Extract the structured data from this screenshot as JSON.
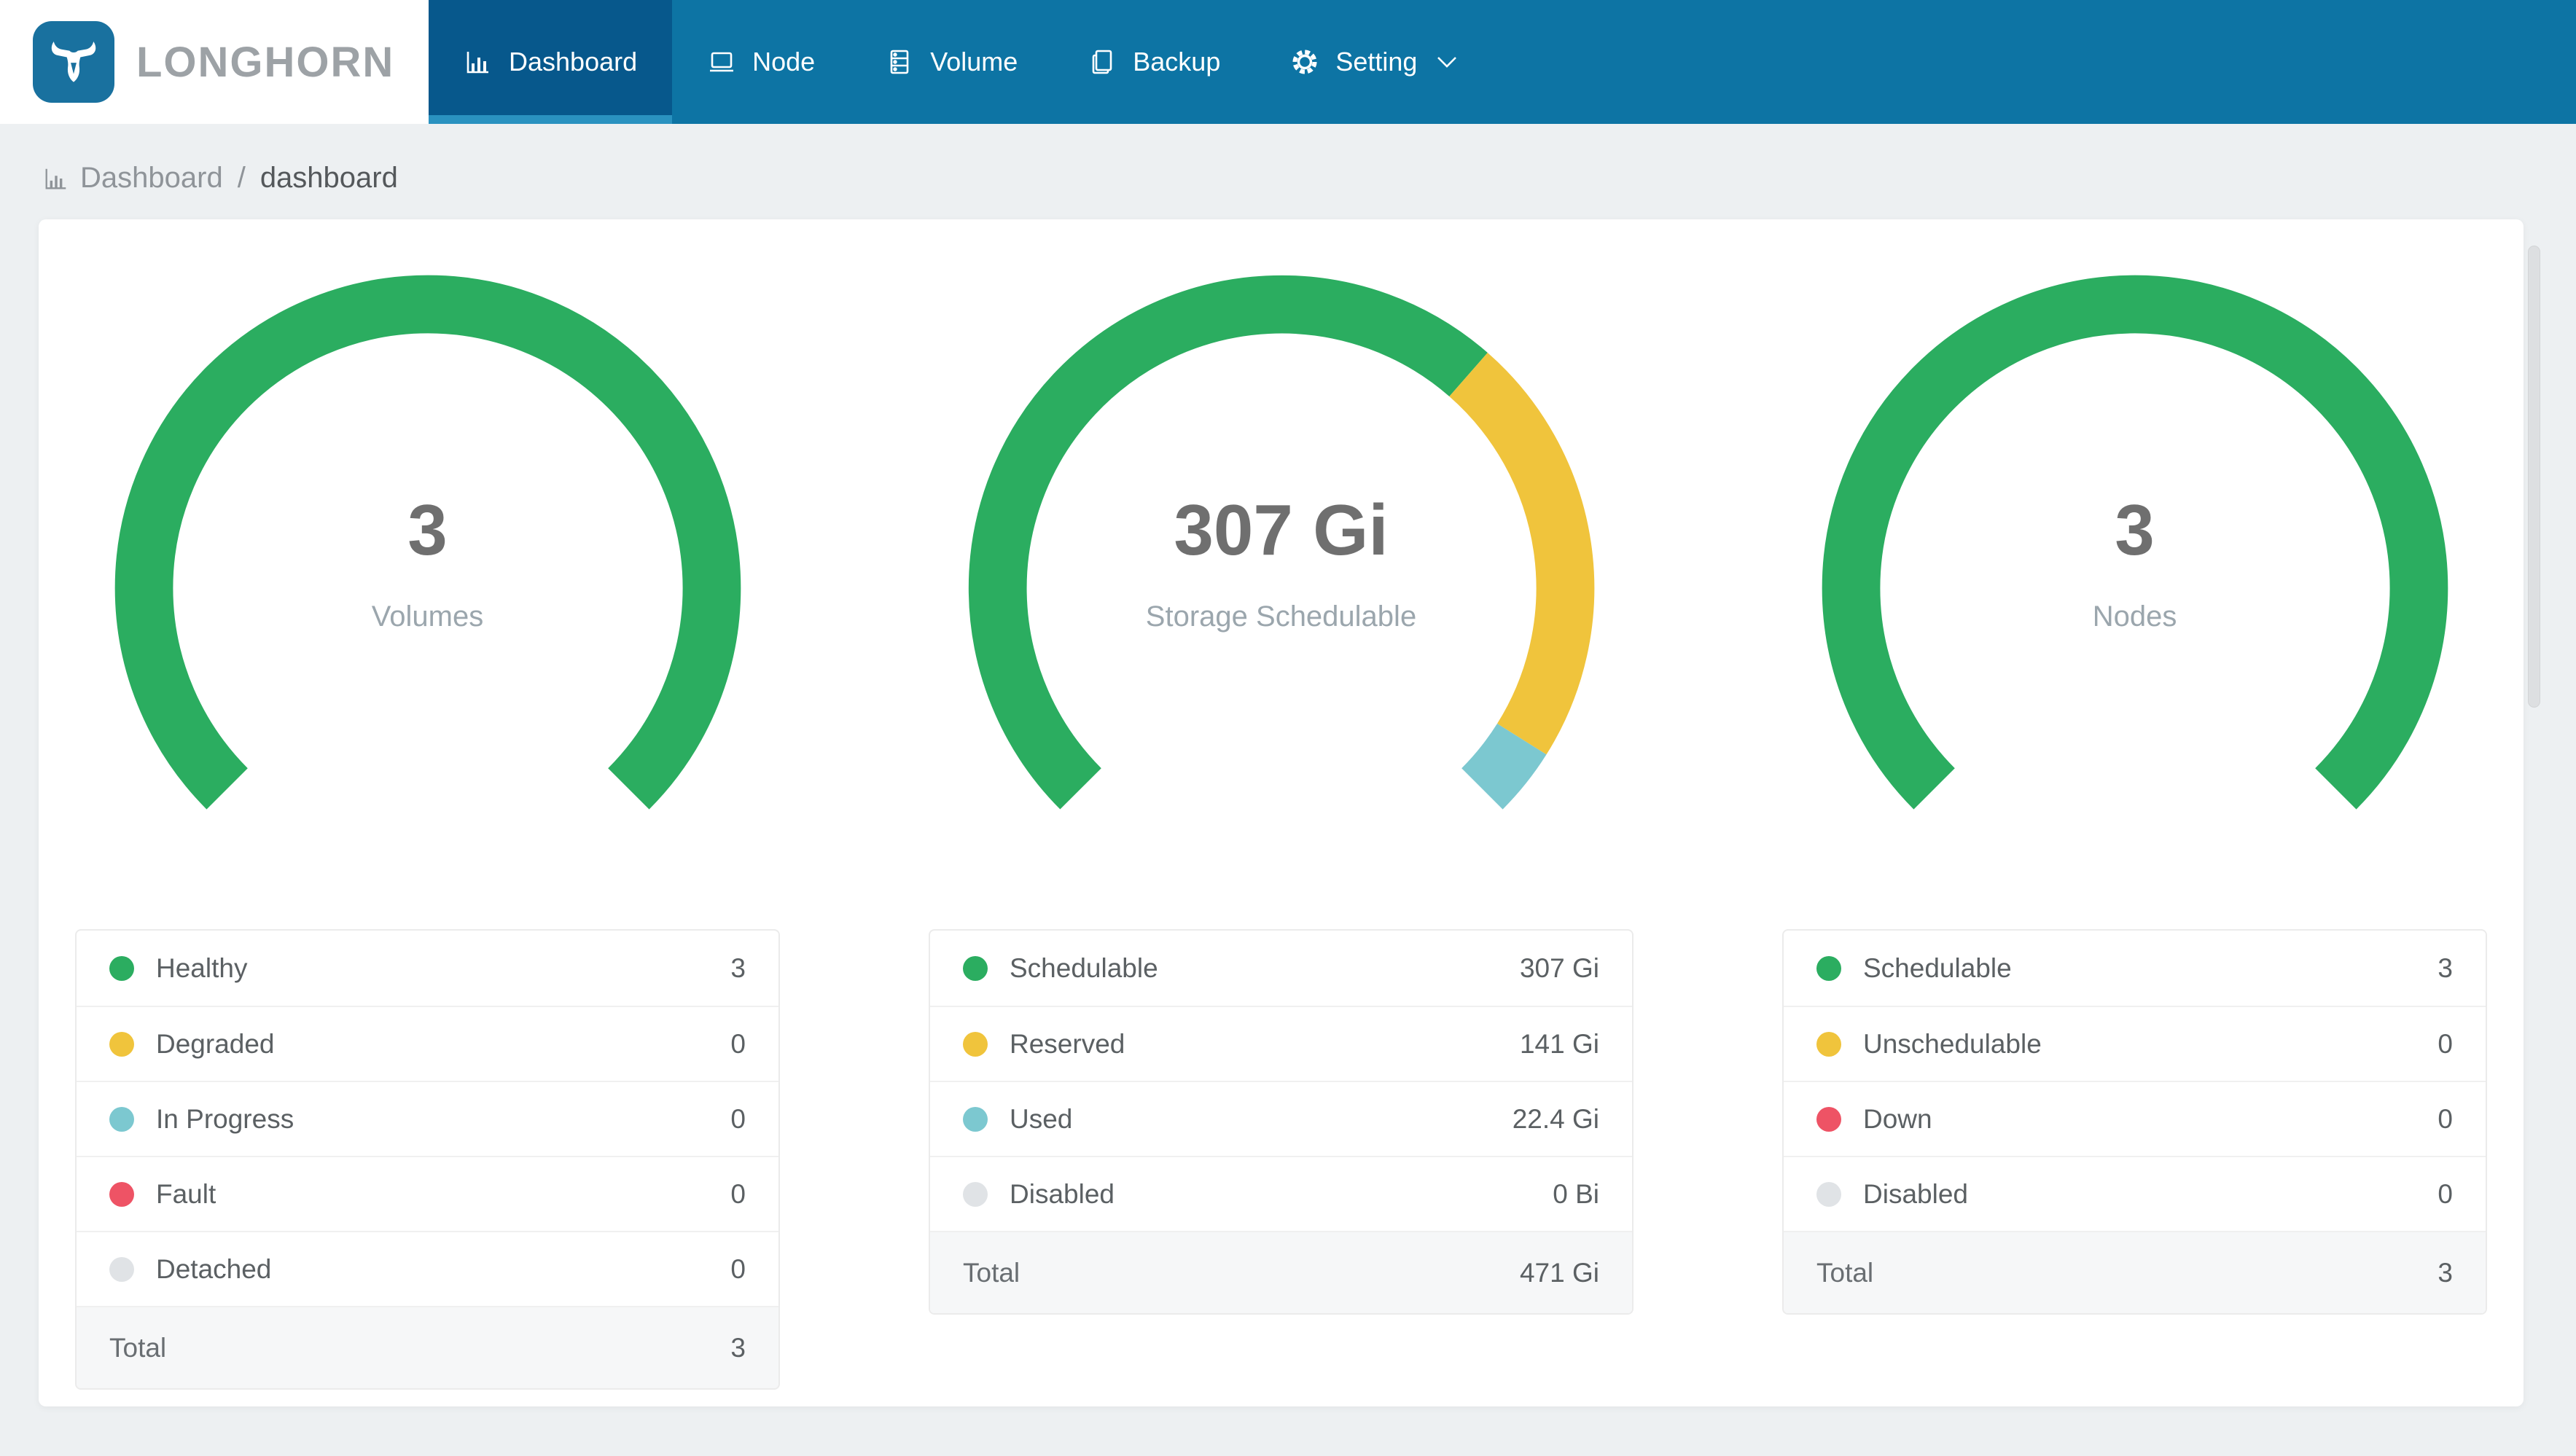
{
  "header": {
    "logo_text": "LONGHORN",
    "nav": [
      {
        "label": "Dashboard",
        "active": true
      },
      {
        "label": "Node",
        "active": false
      },
      {
        "label": "Volume",
        "active": false
      },
      {
        "label": "Backup",
        "active": false
      },
      {
        "label": "Setting",
        "active": false,
        "has_dropdown": true
      }
    ]
  },
  "breadcrumb": {
    "root": "Dashboard",
    "separator": "/",
    "current": "dashboard"
  },
  "colors": {
    "nav_background": "#0d74a4",
    "nav_active": "#07588c",
    "nav_active_indicator": "#2a92c0",
    "logo_blue": "#19719f",
    "page_background": "#edf0f2",
    "healthy_green": "#2bad60",
    "warning_yellow": "#f0c43c",
    "progress_teal": "#7cc8d0",
    "fault_red": "#ee5365",
    "disabled_gray": "#e0e3e6"
  },
  "chart_data": [
    {
      "type": "gauge",
      "center_value": "3",
      "center_label": "Volumes",
      "arc": {
        "start_deg": 135,
        "sweep_deg": 270
      },
      "segments": [
        {
          "label": "Healthy",
          "value": 3,
          "display": "3",
          "color": "#2bad60"
        },
        {
          "label": "Degraded",
          "value": 0,
          "display": "0",
          "color": "#f0c43c"
        },
        {
          "label": "In Progress",
          "value": 0,
          "display": "0",
          "color": "#7cc8d0"
        },
        {
          "label": "Fault",
          "value": 0,
          "display": "0",
          "color": "#ee5365"
        },
        {
          "label": "Detached",
          "value": 0,
          "display": "0",
          "color": "#e0e3e6"
        }
      ],
      "total": {
        "label": "Total",
        "display": "3"
      }
    },
    {
      "type": "gauge",
      "center_value": "307 Gi",
      "center_label": "Storage Schedulable",
      "arc": {
        "start_deg": 135,
        "sweep_deg": 270
      },
      "segments": [
        {
          "label": "Schedulable",
          "value": 307,
          "display": "307 Gi",
          "color": "#2bad60"
        },
        {
          "label": "Reserved",
          "value": 141,
          "display": "141 Gi",
          "color": "#f0c43c"
        },
        {
          "label": "Used",
          "value": 22.4,
          "display": "22.4 Gi",
          "color": "#7cc8d0"
        },
        {
          "label": "Disabled",
          "value": 0,
          "display": "0 Bi",
          "color": "#e0e3e6"
        }
      ],
      "total": {
        "label": "Total",
        "display": "471 Gi"
      }
    },
    {
      "type": "gauge",
      "center_value": "3",
      "center_label": "Nodes",
      "arc": {
        "start_deg": 135,
        "sweep_deg": 270
      },
      "segments": [
        {
          "label": "Schedulable",
          "value": 3,
          "display": "3",
          "color": "#2bad60"
        },
        {
          "label": "Unschedulable",
          "value": 0,
          "display": "0",
          "color": "#f0c43c"
        },
        {
          "label": "Down",
          "value": 0,
          "display": "0",
          "color": "#ee5365"
        },
        {
          "label": "Disabled",
          "value": 0,
          "display": "0",
          "color": "#e0e3e6"
        }
      ],
      "total": {
        "label": "Total",
        "display": "3"
      }
    }
  ]
}
